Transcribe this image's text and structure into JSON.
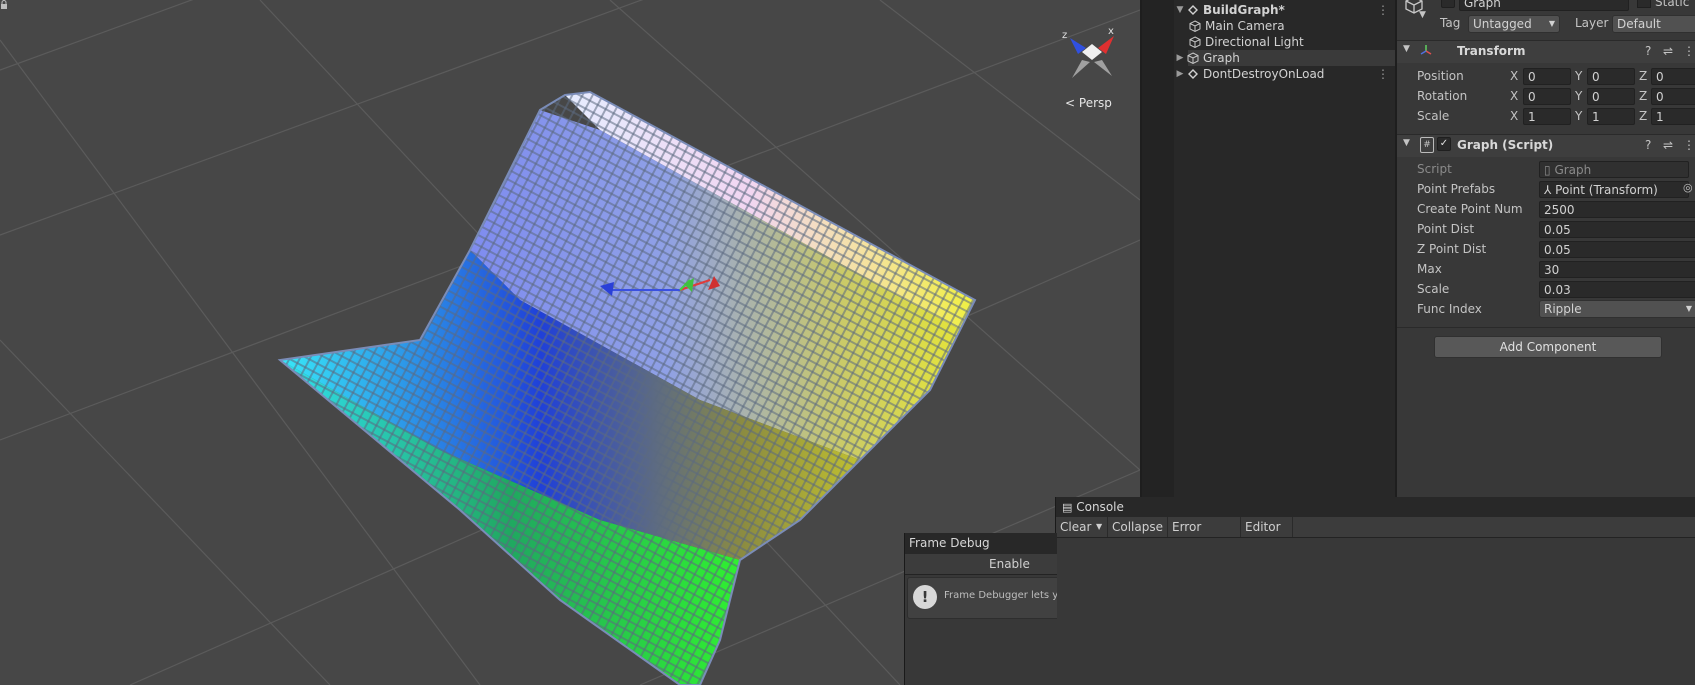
{
  "scene": {
    "view_mode": "Persp",
    "gizmo_axes": {
      "x": "x",
      "z": "z"
    },
    "colors": {
      "background": "#474747",
      "grid": "#5a5a5a"
    }
  },
  "hierarchy": {
    "items": [
      {
        "label": "BuildGraph*",
        "kind": "scene",
        "expanded": true
      },
      {
        "label": "Main Camera",
        "kind": "gameobject"
      },
      {
        "label": "Directional Light",
        "kind": "gameobject"
      },
      {
        "label": "Graph",
        "kind": "gameobject",
        "has_children": true
      },
      {
        "label": "DontDestroyOnLoad",
        "kind": "scene",
        "expanded": false
      }
    ]
  },
  "inspector": {
    "object_name": "Graph",
    "static_label": "Static",
    "tag_label": "Tag",
    "tag_value": "Untagged",
    "layer_label": "Layer",
    "layer_value": "Default",
    "transform": {
      "title": "Transform",
      "rows": [
        {
          "label": "Position",
          "x": "0",
          "y": "0",
          "z": "0"
        },
        {
          "label": "Rotation",
          "x": "0",
          "y": "0",
          "z": "0"
        },
        {
          "label": "Scale",
          "x": "1",
          "y": "1",
          "z": "1"
        }
      ],
      "axis_labels": {
        "x": "X",
        "y": "Y",
        "z": "Z"
      }
    },
    "script": {
      "title": "Graph (Script)",
      "fields": [
        {
          "label": "Script",
          "value": "Graph"
        },
        {
          "label": "Point Prefabs",
          "value": "Point (Transform)"
        },
        {
          "label": "Create Point Num",
          "value": "2500"
        },
        {
          "label": "Point Dist",
          "value": "0.05"
        },
        {
          "label": "Z Point Dist",
          "value": "0.05"
        },
        {
          "label": "Max",
          "value": "30"
        },
        {
          "label": "Scale",
          "value": "0.03"
        },
        {
          "label": "Func Index",
          "value": "Ripple"
        }
      ]
    },
    "add_component": "Add Component"
  },
  "console": {
    "tab": "Console",
    "toolbar": {
      "clear": "Clear",
      "collapse": "Collapse",
      "error_pause": "Error Pause",
      "editor": "Editor"
    }
  },
  "frame_debug": {
    "tab": "Frame Debug",
    "enable": "Enable",
    "message": "Frame Debugger lets you"
  }
}
